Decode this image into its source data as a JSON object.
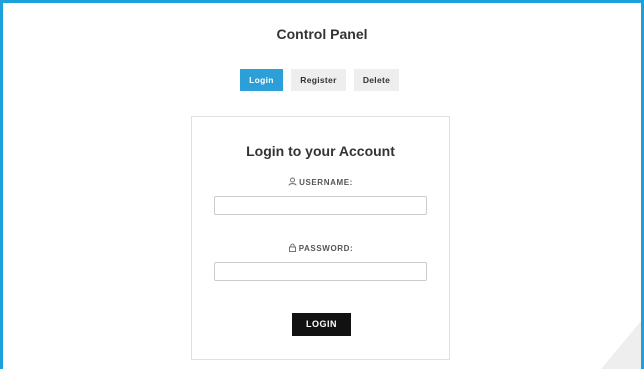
{
  "panel": {
    "title": "Control Panel"
  },
  "tabs": [
    {
      "label": "Login",
      "active": true
    },
    {
      "label": "Register",
      "active": false
    },
    {
      "label": "Delete",
      "active": false
    }
  ],
  "login_form": {
    "heading": "Login to your Account",
    "username": {
      "icon": "user-icon",
      "label": "USERNAME:",
      "value": "",
      "placeholder": ""
    },
    "password": {
      "icon": "lock-icon",
      "label": "PASSWORD:",
      "value": "",
      "placeholder": ""
    },
    "submit_label": "LOGIN"
  },
  "colors": {
    "accent": "#2c9fd8",
    "frame_border": "#1da1db",
    "button_dark": "#111111"
  }
}
